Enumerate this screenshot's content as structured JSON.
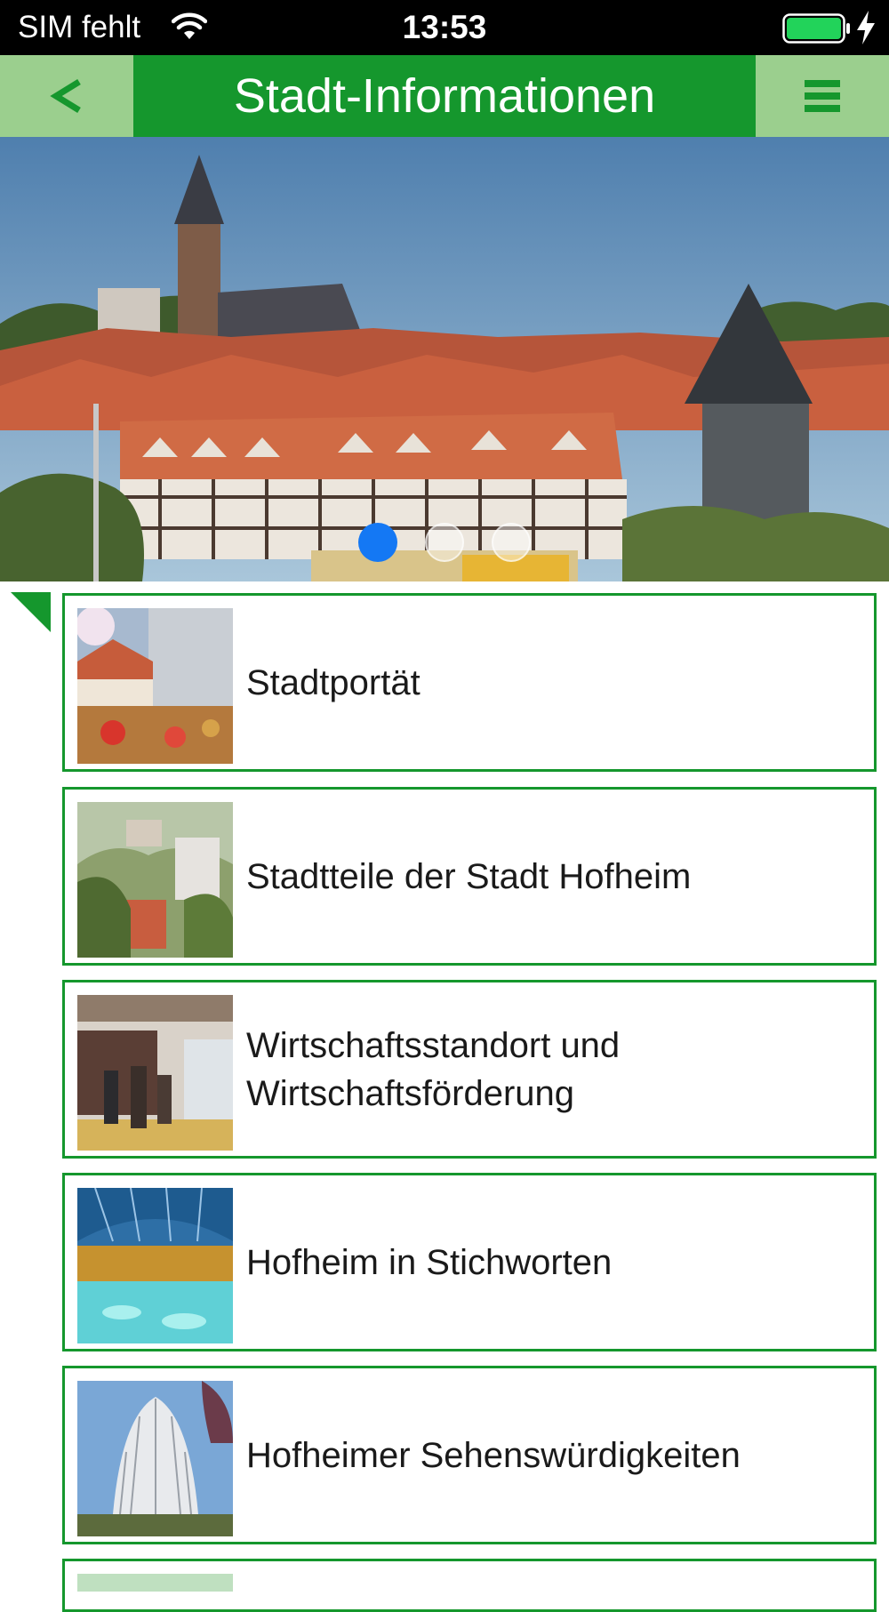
{
  "status_bar": {
    "carrier": "SIM fehlt",
    "time": "13:53",
    "icons": [
      "wifi-icon",
      "battery-icon",
      "charging-bolt-icon"
    ]
  },
  "nav": {
    "back_label": "<",
    "title": "Stadt-Informationen",
    "menu_icon": "hamburger-menu-icon"
  },
  "carousel": {
    "page_count": 3,
    "active_index": 0
  },
  "list": {
    "items": [
      {
        "label": "Stadtportät",
        "thumb": "street-cafe-photo"
      },
      {
        "label": "Stadtteile der Stadt Hofheim",
        "thumb": "townscape-photo"
      },
      {
        "label": "Wirtschaftsstandort und Wirtschaftsförderung",
        "thumb": "trade-fair-photo"
      },
      {
        "label": "Hofheim in Stichworten",
        "thumb": "spa-pool-photo"
      },
      {
        "label": "Hofheimer Sehenswürdigkeiten",
        "thumb": "temple-dome-photo"
      }
    ]
  },
  "colors": {
    "accent_green": "#15972d",
    "light_green": "#9bcf8e",
    "active_dot": "#1478f4"
  }
}
